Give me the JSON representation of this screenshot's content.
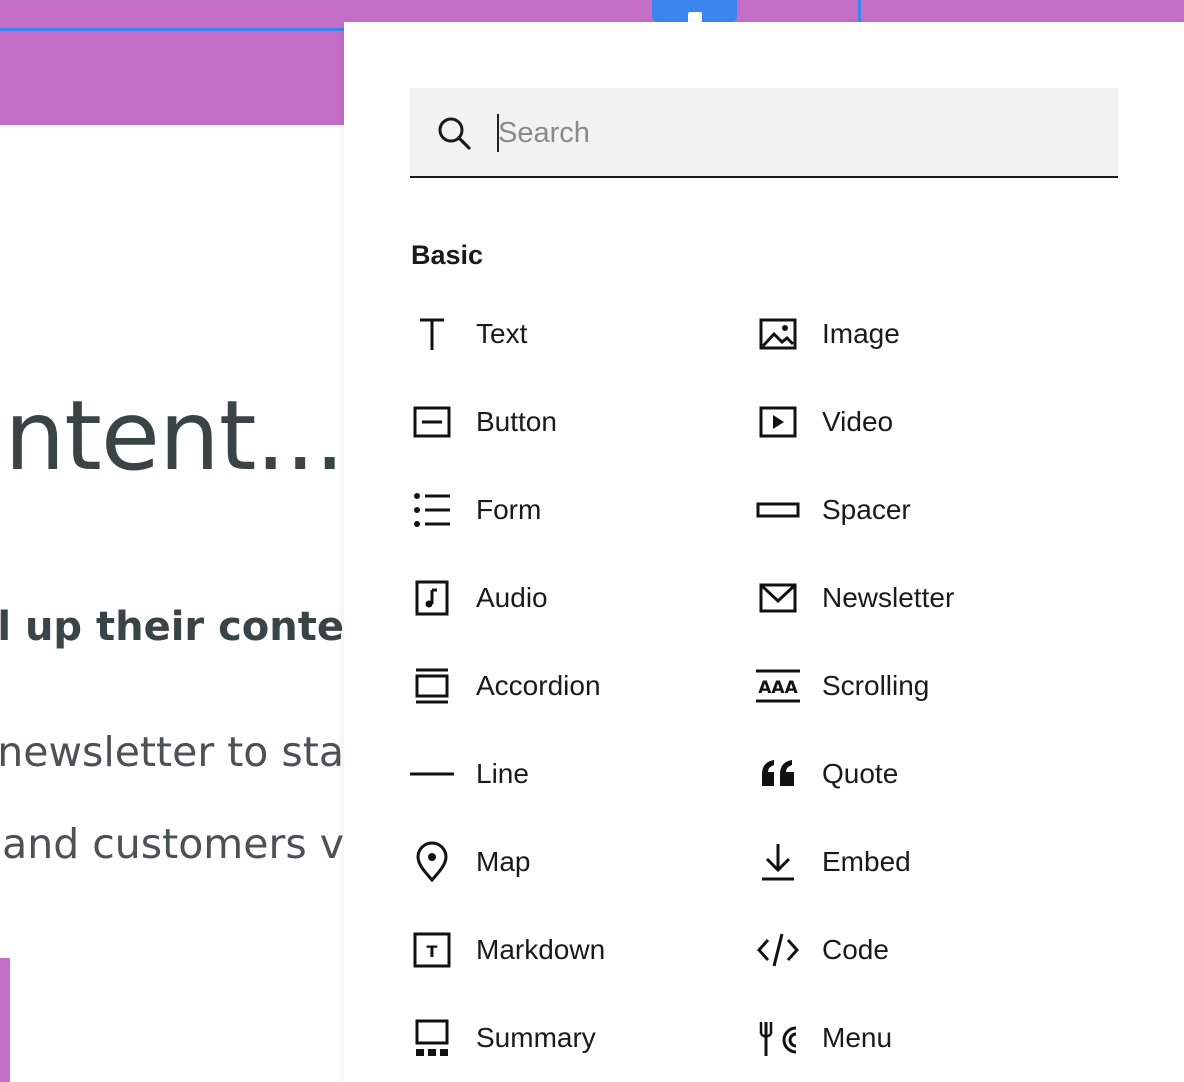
{
  "background_page": {
    "heading": "ntent...",
    "subheading": "vel up their conte",
    "body_line_1": "y newsletter to sta",
    "body_line_2": "ts and customers v"
  },
  "insert_panel": {
    "search": {
      "placeholder": "Search",
      "value": ""
    },
    "section_title": "Basic",
    "blocks": [
      {
        "label": "Text",
        "icon": "text-icon"
      },
      {
        "label": "Image",
        "icon": "image-icon"
      },
      {
        "label": "Button",
        "icon": "button-icon"
      },
      {
        "label": "Video",
        "icon": "video-icon"
      },
      {
        "label": "Form",
        "icon": "form-icon"
      },
      {
        "label": "Spacer",
        "icon": "spacer-icon"
      },
      {
        "label": "Audio",
        "icon": "audio-icon"
      },
      {
        "label": "Newsletter",
        "icon": "newsletter-icon"
      },
      {
        "label": "Accordion",
        "icon": "accordion-icon"
      },
      {
        "label": "Scrolling",
        "icon": "scrolling-icon",
        "icon_text": "AAA"
      },
      {
        "label": "Line",
        "icon": "line-icon"
      },
      {
        "label": "Quote",
        "icon": "quote-icon"
      },
      {
        "label": "Map",
        "icon": "map-pin-icon"
      },
      {
        "label": "Embed",
        "icon": "embed-icon"
      },
      {
        "label": "Markdown",
        "icon": "markdown-icon",
        "icon_text": "T"
      },
      {
        "label": "Code",
        "icon": "code-icon",
        "icon_text": "</>"
      },
      {
        "label": "Summary",
        "icon": "summary-icon"
      },
      {
        "label": "Menu",
        "icon": "menu-icon"
      }
    ]
  },
  "colors": {
    "background_accent": "#c56ec7",
    "selection_blue": "#3a86ef",
    "heading_text": "#3b4444",
    "search_bg": "#f2f2f2"
  }
}
